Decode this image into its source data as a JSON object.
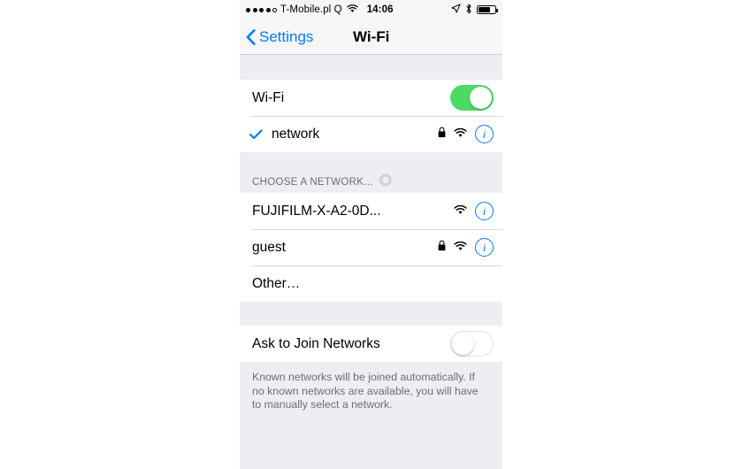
{
  "status_bar": {
    "signal_dots_filled": 4,
    "signal_dots_total": 5,
    "carrier": "T-Mobile.pl Q",
    "wifi_icon": "wifi-icon",
    "time": "14:06",
    "location_icon": "location-arrow-icon",
    "bluetooth_icon": "bluetooth-icon",
    "battery_icon": "battery-icon",
    "battery_level_pct": 72
  },
  "nav_bar": {
    "back_label": "Settings",
    "back_icon": "chevron-left-icon",
    "title": "Wi-Fi"
  },
  "wifi_section": {
    "toggle_label": "Wi-Fi",
    "toggle_state": "on",
    "connected_network": {
      "name": "network",
      "checkmark_icon": "checkmark-icon",
      "lock_icon": "lock-icon",
      "signal_icon": "wifi-icon",
      "info_icon": "info-icon"
    }
  },
  "choose_network": {
    "header": "CHOOSE A NETWORK...",
    "spinner_icon": "activity-spinner-icon",
    "networks": [
      {
        "name": "FUJIFILM-X-A2-0D...",
        "secured": false,
        "lock_icon": "",
        "signal_icon": "wifi-icon",
        "info_icon": "info-icon"
      },
      {
        "name": "guest",
        "secured": true,
        "lock_icon": "lock-icon",
        "signal_icon": "wifi-icon",
        "info_icon": "info-icon"
      },
      {
        "name": "Other…",
        "secured": false,
        "lock_icon": "",
        "signal_icon": "",
        "info_icon": ""
      }
    ]
  },
  "ask_to_join": {
    "label": "Ask to Join Networks",
    "toggle_state": "off",
    "footer": "Known networks will be joined automatically. If no known networks are available, you will have to manually select a network."
  },
  "colors": {
    "ios_blue": "#007aff",
    "ios_green": "#4cd964",
    "group_background": "#eeedf3",
    "row_background": "#ffffff",
    "separator": "#d8d8dc",
    "secondary_text": "#6d6d72"
  }
}
